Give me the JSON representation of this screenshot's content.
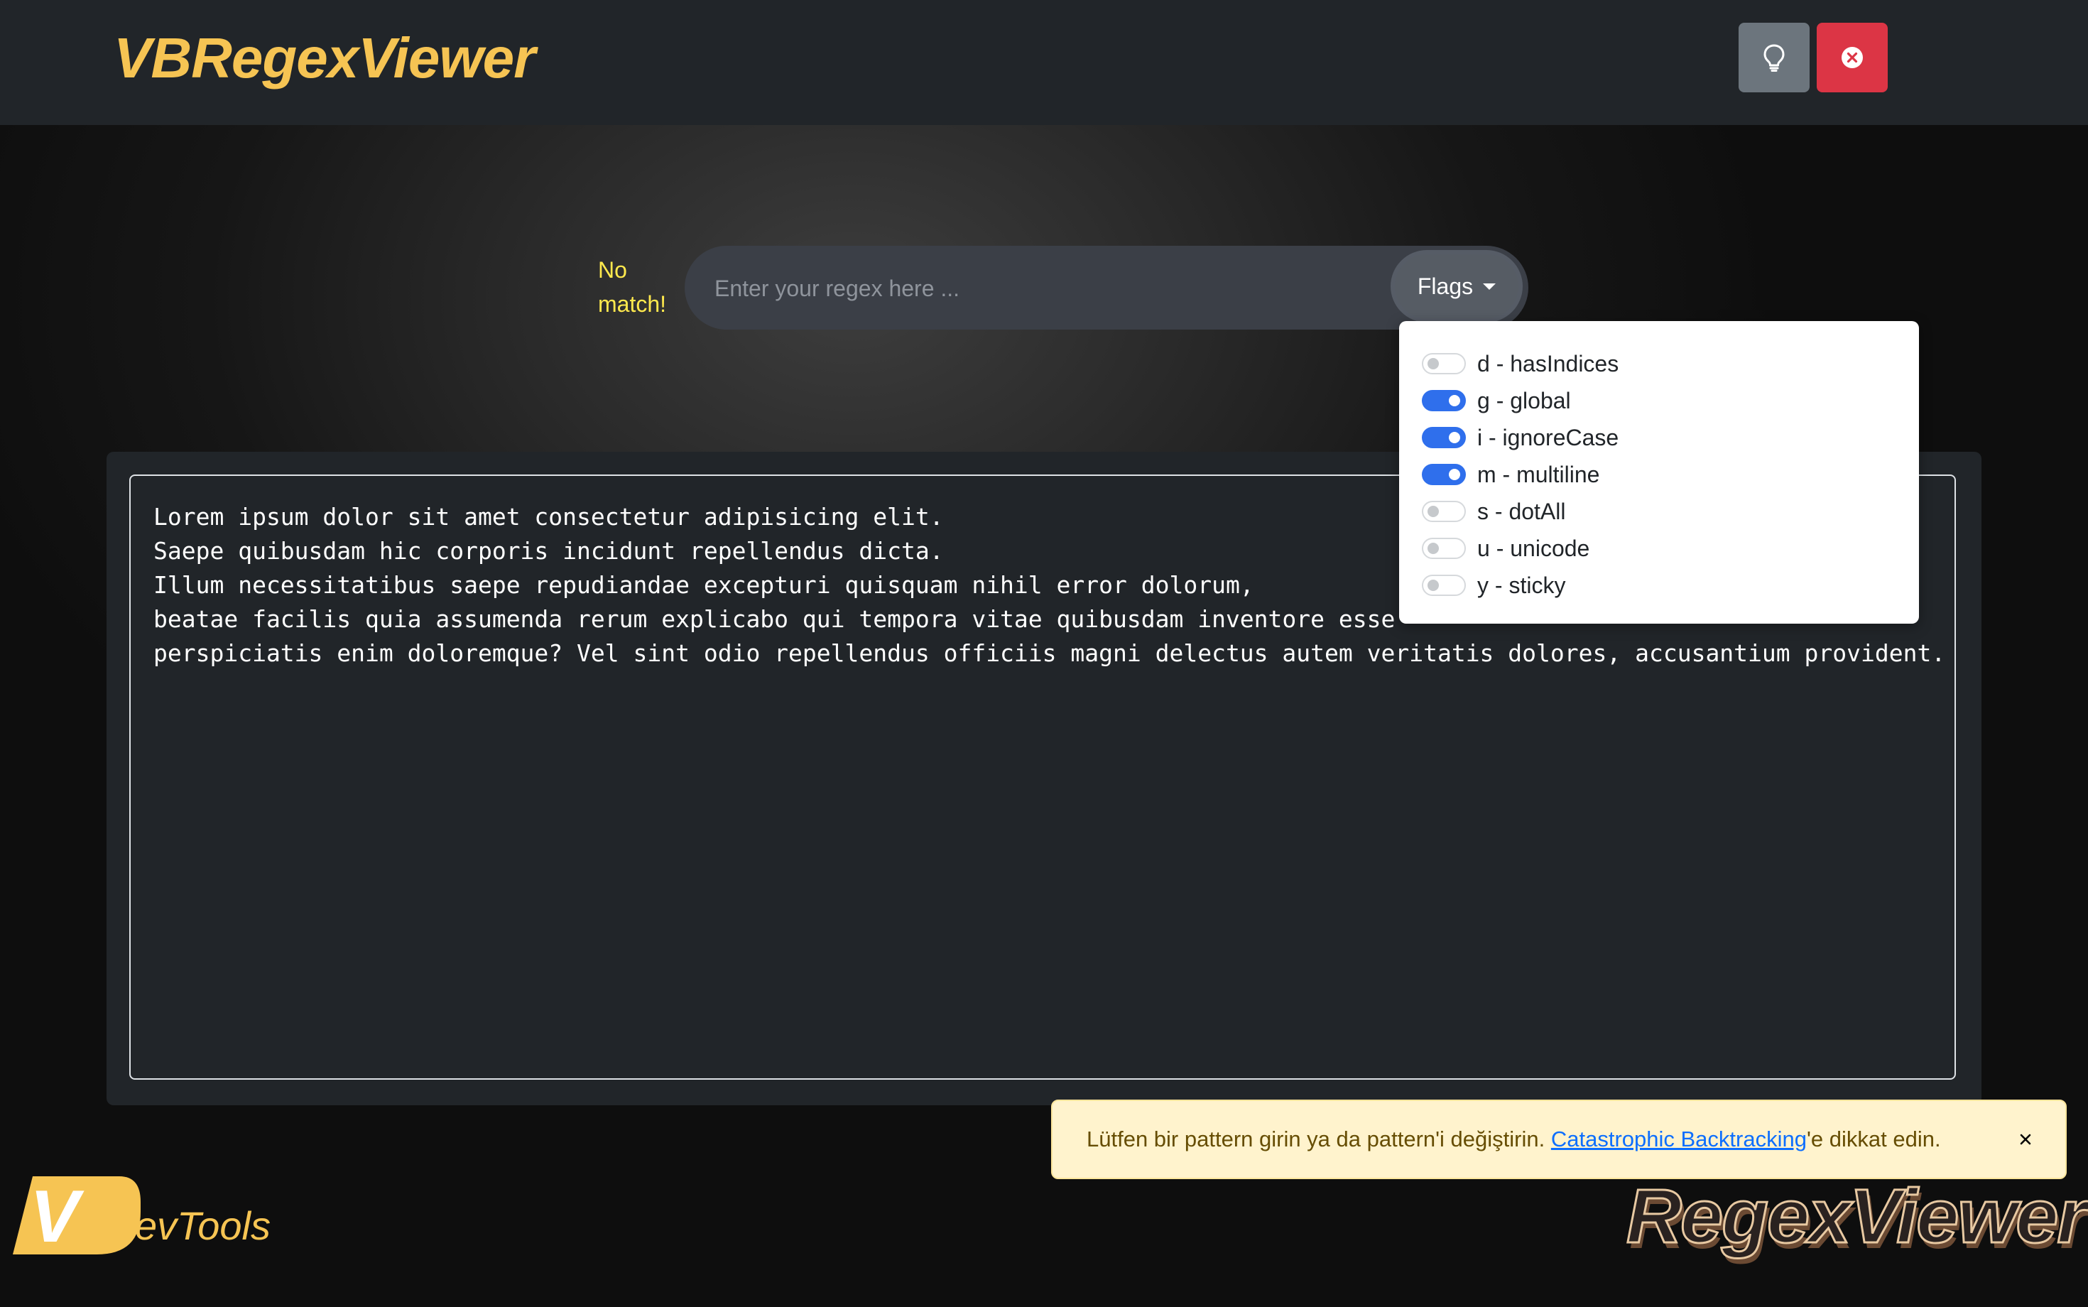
{
  "app": {
    "title": "VBRegexViewer"
  },
  "header": {
    "theme_button_icon": "lightbulb-icon",
    "close_button_icon": "x-circle-icon"
  },
  "status": {
    "no_match": "No match!"
  },
  "regex": {
    "value": "",
    "placeholder": "Enter your regex here ...",
    "flags_label": "Flags"
  },
  "flags": [
    {
      "label": "d - hasIndices",
      "enabled": false
    },
    {
      "label": "g - global",
      "enabled": true
    },
    {
      "label": "i - ignoreCase",
      "enabled": true
    },
    {
      "label": "m - multiline",
      "enabled": true
    },
    {
      "label": "s - dotAll",
      "enabled": false
    },
    {
      "label": "u - unicode",
      "enabled": false
    },
    {
      "label": "y - sticky",
      "enabled": false
    }
  ],
  "test_text": "Lorem ipsum dolor sit amet consectetur adipisicing elit.\nSaepe quibusdam hic corporis incidunt repellendus dicta.\nIllum necessitatibus saepe repudiandae excepturi quisquam nihil error dolorum,\nbeatae facilis quia assumenda rerum explicabo qui tempora vitae quibusdam inventore esse\nperspiciatis enim doloremque? Vel sint odio repellendus officiis magni delectus autem veritatis dolores, accusantium provident.",
  "alert": {
    "text_before": "Lütfen bir pattern girin ya da pattern'i değiştirin. ",
    "link_text": "Catastrophic Backtracking",
    "text_after": "'e dikkat edin.",
    "close_label": "×"
  },
  "footer": {
    "devtools_logo_text": "evTools",
    "devtools_logo_letter": "V",
    "regexviewer_logo_text": "RegexViewer"
  },
  "colors": {
    "brand": "#f6c453",
    "navbar": "#212529",
    "toggle_on": "#2f6fec",
    "close_button": "#dc3545",
    "theme_button": "#6c757d",
    "no_match": "#ffe94d",
    "alert_bg": "#fff3cd",
    "alert_text": "#664d03",
    "link": "#0d6efd"
  }
}
